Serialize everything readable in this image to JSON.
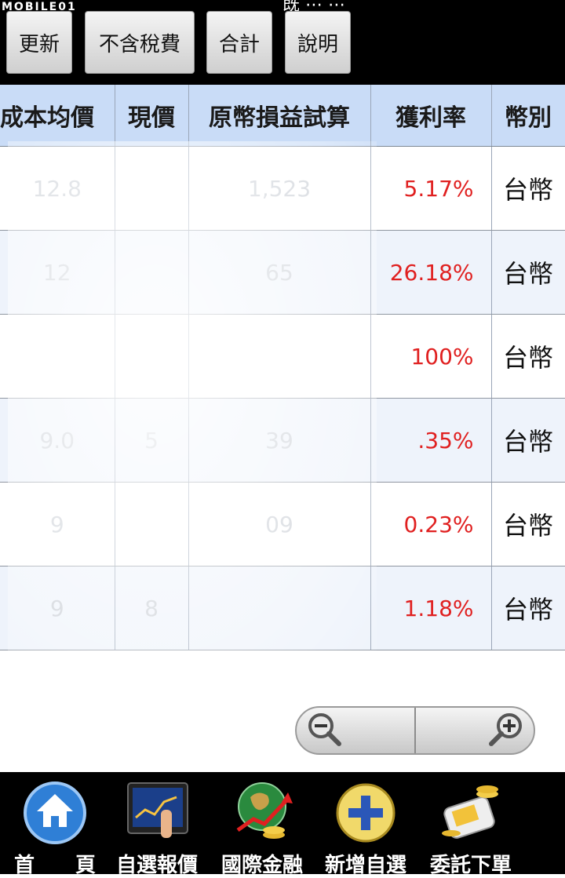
{
  "watermark": "MOBILE01",
  "header_title_fragment": "既 ⋯ ⋯",
  "toolbar": {
    "refresh_label": "更新",
    "tax_label": "不含稅費",
    "total_label": "合計",
    "help_label": "說明"
  },
  "table": {
    "headers": [
      "成本均價",
      "現價",
      "原幣損益試算",
      "獲利率",
      "幣別"
    ],
    "rows": [
      {
        "cost": "12.8",
        "price": "",
        "pnl": "1,523",
        "rate": "5.17%",
        "currency": "台幣"
      },
      {
        "cost": "12",
        "price": "",
        "pnl": "65",
        "rate": "26.18%",
        "currency": "台幣"
      },
      {
        "cost": "",
        "price": "",
        "pnl": "",
        "rate": "100%",
        "currency": "台幣"
      },
      {
        "cost": "9.0",
        "price": "5",
        "pnl": "39",
        "rate": ".35%",
        "currency": "台幣"
      },
      {
        "cost": "9",
        "price": "",
        "pnl": "09",
        "rate": "0.23%",
        "currency": "台幣"
      },
      {
        "cost": "9",
        "price": "8",
        "pnl": "",
        "rate": "1.18%",
        "currency": "台幣"
      }
    ]
  },
  "zoom": {
    "out_icon": "zoom-out-icon",
    "in_icon": "zoom-in-icon"
  },
  "nav": {
    "home_label": "首　　頁",
    "watchlist_label": "自選報價",
    "intl_label": "國際金融",
    "add_watch_label": "新增自選",
    "order_label": "委託下單"
  },
  "colors": {
    "header_bg": "#c9dcf7",
    "gain_red": "#e02020",
    "bar_black": "#000000"
  }
}
